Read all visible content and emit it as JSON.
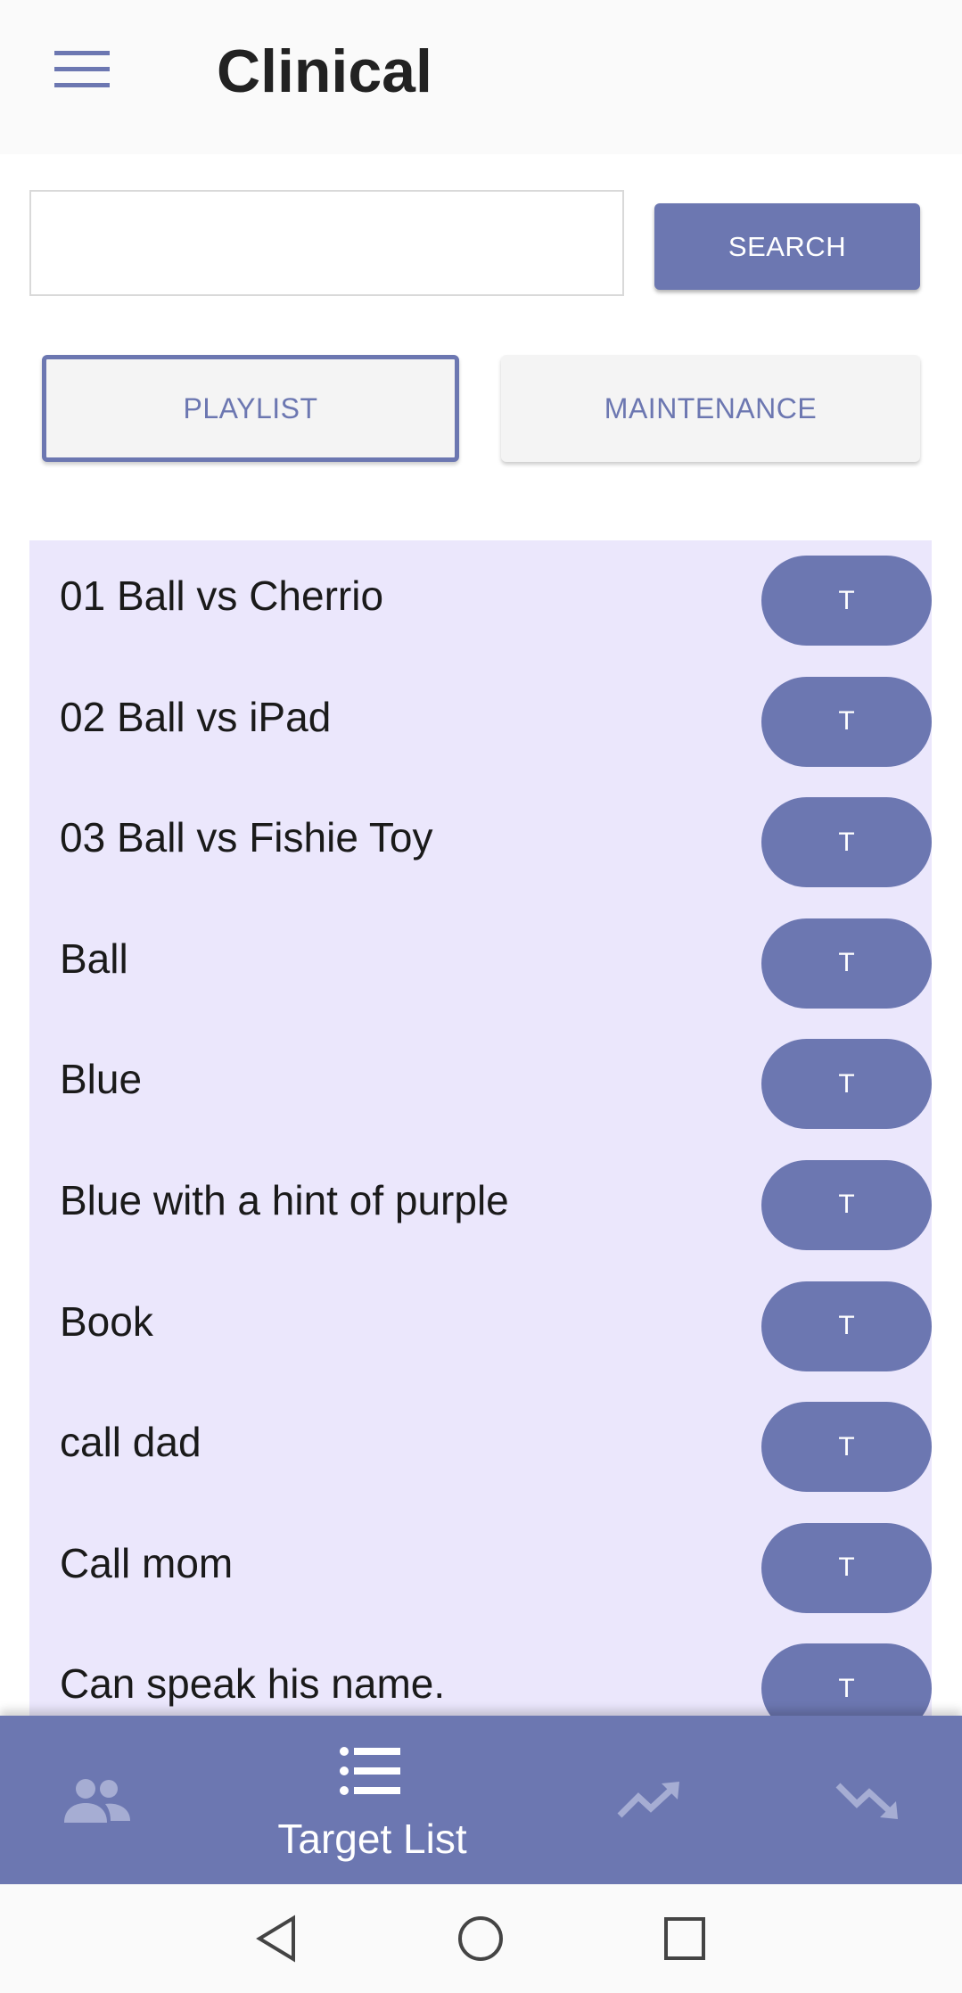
{
  "appbar": {
    "title": "Clinical",
    "menu_icon": "hamburger-menu-icon"
  },
  "search": {
    "value": "",
    "placeholder": "",
    "button_label": "SEARCH"
  },
  "tabs": [
    {
      "label": "PLAYLIST",
      "selected": true
    },
    {
      "label": "MAINTENANCE",
      "selected": false
    }
  ],
  "targets": [
    {
      "label": "01 Ball vs Cherrio",
      "button": "T"
    },
    {
      "label": "02 Ball vs iPad",
      "button": "T"
    },
    {
      "label": "03 Ball vs Fishie Toy",
      "button": "T"
    },
    {
      "label": "Ball",
      "button": "T"
    },
    {
      "label": "Blue",
      "button": "T"
    },
    {
      "label": "Blue with a hint of purple",
      "button": "T"
    },
    {
      "label": "Book",
      "button": "T"
    },
    {
      "label": "call dad",
      "button": "T"
    },
    {
      "label": "Call mom",
      "button": "T"
    },
    {
      "label": "Can speak his name.",
      "button": "T"
    }
  ],
  "bottom_nav": {
    "items": [
      {
        "icon": "people-icon",
        "label": ""
      },
      {
        "icon": "list-icon",
        "label": "Target List",
        "active": true
      },
      {
        "icon": "trending-up-icon",
        "label": ""
      },
      {
        "icon": "trending-down-icon",
        "label": ""
      }
    ]
  },
  "system_nav": {
    "icons": [
      "back-icon",
      "home-icon",
      "recents-icon"
    ]
  },
  "colors": {
    "accent": "#6c77b1",
    "list_background": "#ebe7fc",
    "appbar_background": "#fafafa",
    "title_text": "#222222"
  }
}
